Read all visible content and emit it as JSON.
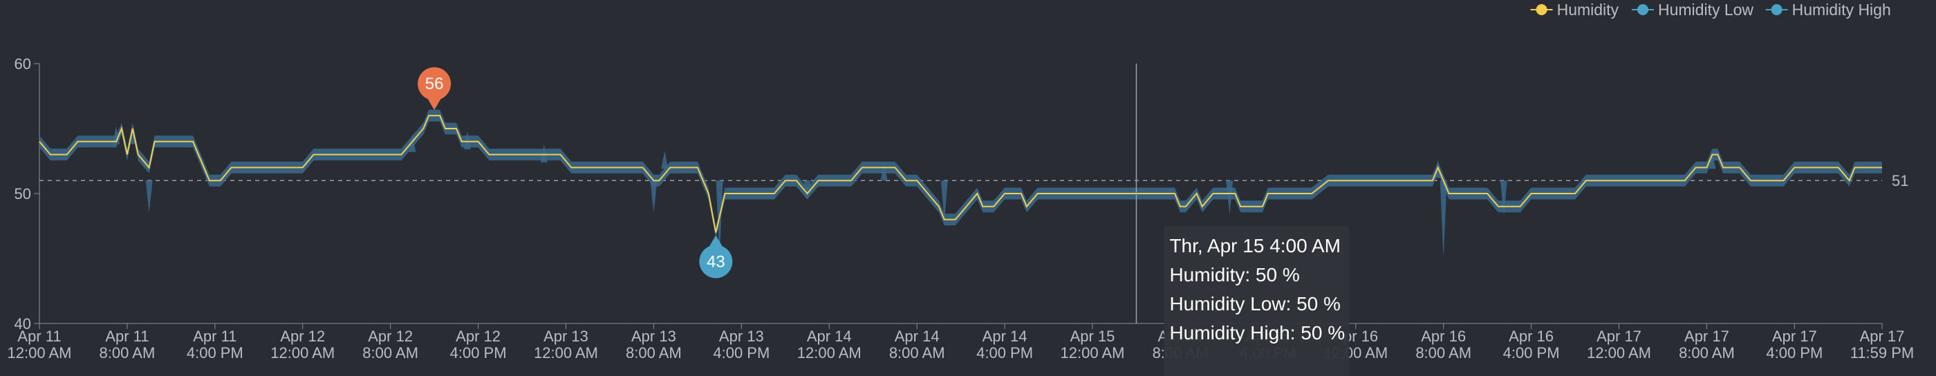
{
  "chart_data": {
    "type": "line",
    "title": "",
    "xlabel": "",
    "ylabel": "",
    "ylim": [
      40,
      60
    ],
    "yticks": [
      40,
      50,
      60
    ],
    "x_range": [
      "2021-04-11T00:00",
      "2021-04-17T23:59"
    ],
    "x_ticks": [
      {
        "t": "2021-04-11T00:00",
        "line1": "Apr 11",
        "line2": "12:00 AM"
      },
      {
        "t": "2021-04-11T08:00",
        "line1": "Apr 11",
        "line2": "8:00 AM"
      },
      {
        "t": "2021-04-11T16:00",
        "line1": "Apr 11",
        "line2": "4:00 PM"
      },
      {
        "t": "2021-04-12T00:00",
        "line1": "Apr 12",
        "line2": "12:00 AM"
      },
      {
        "t": "2021-04-12T08:00",
        "line1": "Apr 12",
        "line2": "8:00 AM"
      },
      {
        "t": "2021-04-12T16:00",
        "line1": "Apr 12",
        "line2": "4:00 PM"
      },
      {
        "t": "2021-04-13T00:00",
        "line1": "Apr 13",
        "line2": "12:00 AM"
      },
      {
        "t": "2021-04-13T08:00",
        "line1": "Apr 13",
        "line2": "8:00 AM"
      },
      {
        "t": "2021-04-13T16:00",
        "line1": "Apr 13",
        "line2": "4:00 PM"
      },
      {
        "t": "2021-04-14T00:00",
        "line1": "Apr 14",
        "line2": "12:00 AM"
      },
      {
        "t": "2021-04-14T08:00",
        "line1": "Apr 14",
        "line2": "8:00 AM"
      },
      {
        "t": "2021-04-14T16:00",
        "line1": "Apr 14",
        "line2": "4:00 PM"
      },
      {
        "t": "2021-04-15T00:00",
        "line1": "Apr 15",
        "line2": "12:00 AM"
      },
      {
        "t": "2021-04-15T08:00",
        "line1": "Apr 15",
        "line2": "8:00 AM"
      },
      {
        "t": "2021-04-15T16:00",
        "line1": "Apr 15",
        "line2": "4:00 PM"
      },
      {
        "t": "2021-04-16T00:00",
        "line1": "Apr 16",
        "line2": "12:00 AM"
      },
      {
        "t": "2021-04-16T08:00",
        "line1": "Apr 16",
        "line2": "8:00 AM"
      },
      {
        "t": "2021-04-16T16:00",
        "line1": "Apr 16",
        "line2": "4:00 PM"
      },
      {
        "t": "2021-04-17T00:00",
        "line1": "Apr 17",
        "line2": "12:00 AM"
      },
      {
        "t": "2021-04-17T08:00",
        "line1": "Apr 17",
        "line2": "8:00 AM"
      },
      {
        "t": "2021-04-17T16:00",
        "line1": "Apr 17",
        "line2": "4:00 PM"
      },
      {
        "t": "2021-04-17T23:59",
        "line1": "Apr 17",
        "line2": "11:59 PM"
      }
    ],
    "legend_position": "top-right",
    "series": [
      {
        "name": "Humidity",
        "color": "#f3cd4b"
      },
      {
        "name": "Humidity Low",
        "color": "#4aa3c7"
      },
      {
        "name": "Humidity High",
        "color": "#4aa3c7"
      }
    ],
    "reference_line": {
      "value": 51,
      "label": "51"
    },
    "humidity_points": [
      [
        "2021-04-11T00:00",
        54
      ],
      [
        "2021-04-11T01:00",
        53
      ],
      [
        "2021-04-11T02:30",
        53
      ],
      [
        "2021-04-11T03:30",
        54
      ],
      [
        "2021-04-11T06:30",
        54
      ],
      [
        "2021-04-11T07:00",
        54
      ],
      [
        "2021-04-11T07:30",
        55
      ],
      [
        "2021-04-11T08:00",
        53
      ],
      [
        "2021-04-11T08:30",
        55
      ],
      [
        "2021-04-11T09:00",
        53
      ],
      [
        "2021-04-11T10:00",
        52
      ],
      [
        "2021-04-11T10:30",
        54
      ],
      [
        "2021-04-11T14:00",
        54
      ],
      [
        "2021-04-11T15:30",
        51
      ],
      [
        "2021-04-11T16:30",
        51
      ],
      [
        "2021-04-11T17:30",
        52
      ],
      [
        "2021-04-12T00:00",
        52
      ],
      [
        "2021-04-12T01:00",
        53
      ],
      [
        "2021-04-12T08:00",
        53
      ],
      [
        "2021-04-12T09:00",
        53
      ],
      [
        "2021-04-12T10:00",
        54
      ],
      [
        "2021-04-12T11:00",
        55
      ],
      [
        "2021-04-12T11:30",
        56
      ],
      [
        "2021-04-12T12:30",
        56
      ],
      [
        "2021-04-12T13:00",
        55
      ],
      [
        "2021-04-12T14:00",
        55
      ],
      [
        "2021-04-12T14:30",
        54
      ],
      [
        "2021-04-12T16:00",
        54
      ],
      [
        "2021-04-12T17:00",
        53
      ],
      [
        "2021-04-12T23:30",
        53
      ],
      [
        "2021-04-13T00:30",
        52
      ],
      [
        "2021-04-13T07:00",
        52
      ],
      [
        "2021-04-13T08:00",
        51
      ],
      [
        "2021-04-13T08:30",
        51
      ],
      [
        "2021-04-13T09:30",
        52
      ],
      [
        "2021-04-13T12:00",
        52
      ],
      [
        "2021-04-13T13:00",
        50
      ],
      [
        "2021-04-13T13:40",
        47
      ],
      [
        "2021-04-13T14:30",
        50
      ],
      [
        "2021-04-13T19:00",
        50
      ],
      [
        "2021-04-13T20:00",
        51
      ],
      [
        "2021-04-13T21:00",
        51
      ],
      [
        "2021-04-13T22:00",
        50
      ],
      [
        "2021-04-13T23:00",
        51
      ],
      [
        "2021-04-14T02:00",
        51
      ],
      [
        "2021-04-14T03:00",
        52
      ],
      [
        "2021-04-14T06:00",
        52
      ],
      [
        "2021-04-14T07:00",
        51
      ],
      [
        "2021-04-14T08:00",
        51
      ],
      [
        "2021-04-14T09:00",
        50
      ],
      [
        "2021-04-14T10:00",
        49
      ],
      [
        "2021-04-14T10:30",
        48
      ],
      [
        "2021-04-14T11:30",
        48
      ],
      [
        "2021-04-14T12:30",
        49
      ],
      [
        "2021-04-14T13:30",
        50
      ],
      [
        "2021-04-14T14:00",
        49
      ],
      [
        "2021-04-14T15:00",
        49
      ],
      [
        "2021-04-14T16:00",
        50
      ],
      [
        "2021-04-14T17:30",
        50
      ],
      [
        "2021-04-14T18:00",
        49
      ],
      [
        "2021-04-14T19:00",
        50
      ],
      [
        "2021-04-15T07:30",
        50
      ],
      [
        "2021-04-15T08:00",
        49
      ],
      [
        "2021-04-15T08:30",
        49
      ],
      [
        "2021-04-15T09:30",
        50
      ],
      [
        "2021-04-15T10:00",
        49
      ],
      [
        "2021-04-15T11:00",
        50
      ],
      [
        "2021-04-15T13:00",
        50
      ],
      [
        "2021-04-15T13:30",
        49
      ],
      [
        "2021-04-15T15:30",
        49
      ],
      [
        "2021-04-15T16:00",
        50
      ],
      [
        "2021-04-15T20:00",
        50
      ],
      [
        "2021-04-15T21:30",
        51
      ],
      [
        "2021-04-16T07:00",
        51
      ],
      [
        "2021-04-16T07:30",
        52
      ],
      [
        "2021-04-16T08:30",
        50
      ],
      [
        "2021-04-16T12:00",
        50
      ],
      [
        "2021-04-16T13:00",
        49
      ],
      [
        "2021-04-16T15:00",
        49
      ],
      [
        "2021-04-16T16:00",
        50
      ],
      [
        "2021-04-16T20:00",
        50
      ],
      [
        "2021-04-16T21:00",
        51
      ],
      [
        "2021-04-17T06:00",
        51
      ],
      [
        "2021-04-17T07:00",
        52
      ],
      [
        "2021-04-17T08:00",
        52
      ],
      [
        "2021-04-17T08:30",
        53
      ],
      [
        "2021-04-17T09:00",
        53
      ],
      [
        "2021-04-17T09:30",
        52
      ],
      [
        "2021-04-17T11:00",
        52
      ],
      [
        "2021-04-17T12:00",
        51
      ],
      [
        "2021-04-17T15:00",
        51
      ],
      [
        "2021-04-17T16:00",
        52
      ],
      [
        "2021-04-17T20:00",
        52
      ],
      [
        "2021-04-17T21:00",
        51
      ],
      [
        "2021-04-17T21:30",
        52
      ],
      [
        "2021-04-17T23:59",
        52
      ]
    ],
    "humidity_low_dips": [
      [
        "2021-04-11T10:00",
        48.5
      ],
      [
        "2021-04-13T08:00",
        48.5
      ],
      [
        "2021-04-13T14:00",
        45
      ],
      [
        "2021-04-13T22:00",
        49.5
      ],
      [
        "2021-04-14T10:30",
        47.8
      ],
      [
        "2021-04-15T12:30",
        48.4
      ],
      [
        "2021-04-16T08:00",
        45
      ],
      [
        "2021-04-16T13:30",
        48.3
      ]
    ],
    "humidity_high_peaks": [
      [
        "2021-04-11T07:00",
        55.2
      ],
      [
        "2021-04-11T08:30",
        55.2
      ],
      [
        "2021-04-12T10:00",
        54.6
      ],
      [
        "2021-04-12T15:00",
        54.8
      ],
      [
        "2021-04-12T22:00",
        53.8
      ],
      [
        "2021-04-13T09:00",
        53.3
      ],
      [
        "2021-04-14T05:00",
        52.4
      ],
      [
        "2021-04-16T07:30",
        52.6
      ],
      [
        "2021-04-17T08:30",
        53.3
      ]
    ],
    "markers": [
      {
        "t": "2021-04-12T12:00",
        "value": 56,
        "label": "56",
        "kind": "max",
        "color": "#e8734a"
      },
      {
        "t": "2021-04-13T13:40",
        "value": 47,
        "label": "43",
        "kind": "min",
        "color": "#4aa3c7"
      }
    ],
    "tooltip": {
      "t": "2021-04-15T04:00",
      "title": "Thr, Apr 15 4:00 AM",
      "lines": [
        "Humidity: 50 %",
        "Humidity Low: 50 %",
        "Humidity High: 50 %"
      ]
    }
  }
}
